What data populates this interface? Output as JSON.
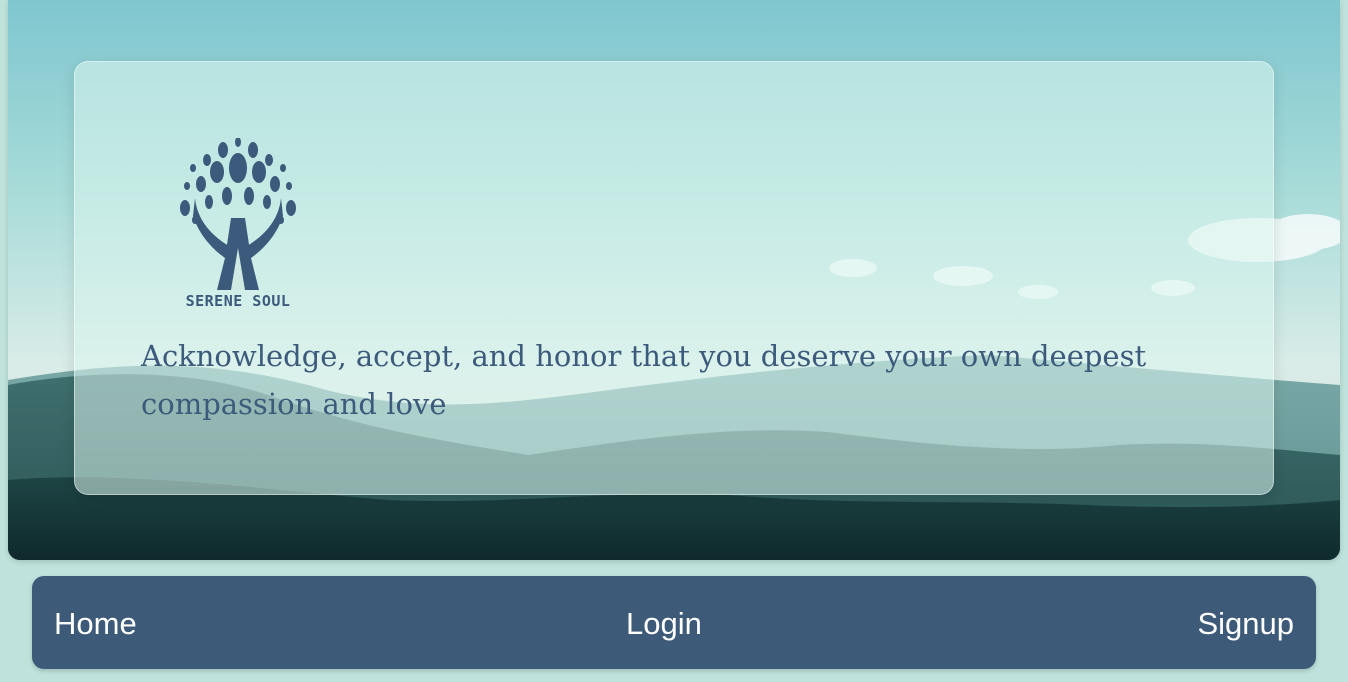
{
  "brand": {
    "name": "SERENE SOUL",
    "logo_icon": "tree-hands-icon",
    "color": "#3c5a7c"
  },
  "hero": {
    "quote": "Acknowledge, accept, and honor that you deserve your own deepest compassion and love",
    "scene": "mountain-landscape"
  },
  "nav": {
    "background": "#3d5a79",
    "items": [
      {
        "label": "Home"
      },
      {
        "label": "Login"
      },
      {
        "label": "Signup"
      }
    ]
  }
}
